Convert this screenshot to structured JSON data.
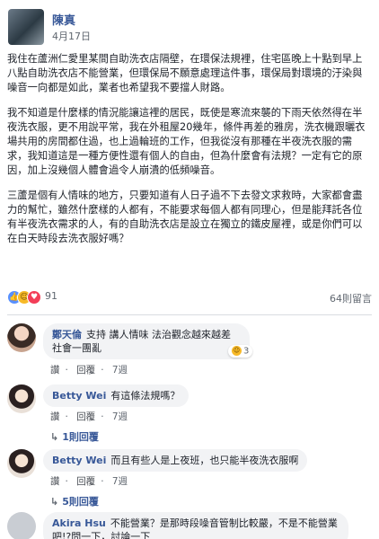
{
  "post": {
    "author": "陳真",
    "date": "4月17日",
    "paragraphs": [
      "我住在蘆洲仁愛里某間自助洗衣店隔壁，在環保法規裡，住宅區晚上十點到早上八點自助洗衣店不能營業，但環保局不願意處理這件事，環保局對環境的汙染與噪音一向都是如此，業者也希望我不要擋人財路。",
      "我不知道是什麼樣的情況能讓這裡的居民，既使是寒流來襲的下雨天依然得在半夜洗衣服，更不用說平常，我在外租屋20幾年，條件再差的雅房，洗衣機跟曬衣場共用的房間都住過，也上過輪班的工作，但我從沒有那種在半夜洗衣服的需求，我知道這是一種方便性還有個人的自由，但為什麼會有法規？一定有它的原因，加上沒幾個人體會過令人崩潰的低頻噪音。",
      "三蘆是個有人情味的地方，只要知道有人日子過不下去發文求救時，大家都會盡力的幫忙，雖然什麼樣的人都有，不能要求每個人都有同理心，但是能拜託各位有半夜洗衣需求的人，有的自助洗衣店是設立在獨立的鐵皮屋裡，或是你們可以在白天時段去洗衣服好嗎？"
    ],
    "reaction_count": "91",
    "share_count": "64則留言"
  },
  "comments": [
    {
      "author": "鄭天倫",
      "text_line1": "支持 講人情味 法治觀念越來越差",
      "text_line2": "社會一團亂",
      "like_label": "讚",
      "reply_label": "回覆",
      "time": "7週",
      "reaction_count": "3"
    },
    {
      "author": "Betty Wei",
      "text": "有這條法規嗎？",
      "like_label": "讚",
      "reply_label": "回覆",
      "time": "7週",
      "replies_label": "1則回覆"
    },
    {
      "author": "Betty Wei",
      "text": "而且有些人是上夜班，也只能半夜洗衣服啊",
      "like_label": "讚",
      "reply_label": "回覆",
      "time": "7週",
      "replies_label": "5則回覆"
    },
    {
      "author": "Akira Hsu",
      "text_line1": "不能營業？是那時段噪音管制比較嚴，不是不能營業",
      "text_line2": "吧!?問一下，討論一下"
    }
  ],
  "separator": "·"
}
